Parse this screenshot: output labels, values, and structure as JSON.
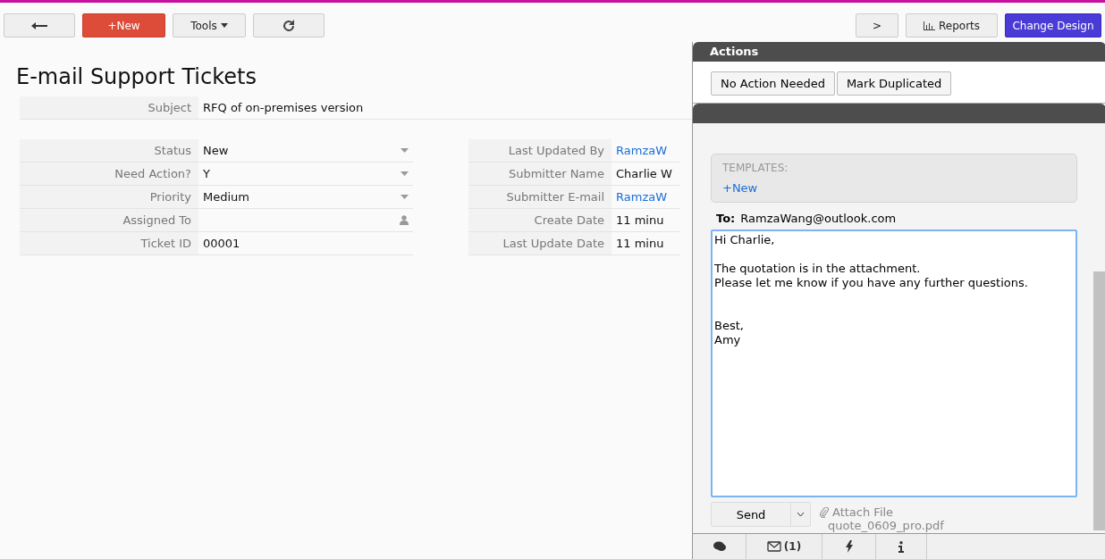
{
  "toolbar": {
    "new_label": "+New",
    "tools_label": "Tools",
    "next_label": ">",
    "reports_label": "Reports",
    "change_design_label": "Change Design"
  },
  "title": "E-mail Support Tickets",
  "subject": {
    "label": "Subject",
    "value": "RFQ of on-premises version"
  },
  "left_fields": [
    {
      "label": "Status",
      "value": "New",
      "kind": "select"
    },
    {
      "label": "Need Action?",
      "value": "Y",
      "kind": "select"
    },
    {
      "label": "Priority",
      "value": "Medium",
      "kind": "select"
    },
    {
      "label": "Assigned To",
      "kind": "user"
    },
    {
      "label": "Ticket ID",
      "value": "00001",
      "kind": "text"
    }
  ],
  "right_fields": [
    {
      "label": "Last Updated By",
      "value": "RamzaW",
      "kind": "link"
    },
    {
      "label": "Submitter Name",
      "value": "Charlie W",
      "kind": "text"
    },
    {
      "label": "Submitter E-mail",
      "value": "RamzaW",
      "kind": "link"
    },
    {
      "label": "Create Date",
      "value": "11 minu",
      "kind": "text"
    },
    {
      "label": "Last Update Date",
      "value": "11 minu",
      "kind": "text"
    }
  ],
  "panel": {
    "actions_title": "Actions",
    "actions": [
      "No Action Needed",
      "Mark Duplicated"
    ],
    "templates_label": "TEMPLATES:",
    "templates_new": "+New",
    "to_label": "To:",
    "to_value": "RamzaWang@outlook.com",
    "message": "Hi Charlie,\n\nThe quotation is in the attachment.\nPlease let me know if you have any further questions.\n\n\nBest,\nAmy",
    "send_label": "Send",
    "attach_label": "Attach File",
    "attachment": "quote_0609_pro.pdf",
    "tabs": [
      {
        "kind": "comments"
      },
      {
        "kind": "mail",
        "count": "(1)"
      },
      {
        "kind": "bolt"
      },
      {
        "kind": "info"
      }
    ]
  }
}
